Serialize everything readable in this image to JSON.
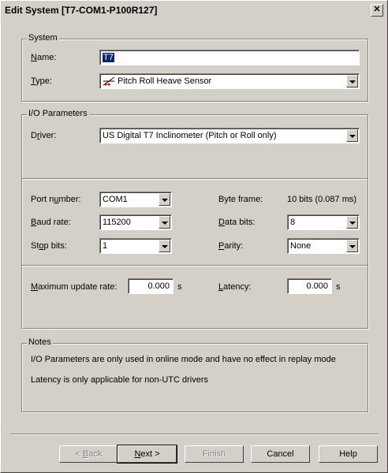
{
  "window": {
    "title": "Edit System [T7-COM1-P100R127]",
    "close_glyph": "✕"
  },
  "system": {
    "legend": "System",
    "name_label_u": "N",
    "name_label_rest": "ame:",
    "name_value": "T7",
    "type_label_u": "T",
    "type_label_rest": "ype:",
    "type_value": "Pitch Roll Heave Sensor",
    "type_icon": "pitch-roll-heave-icon"
  },
  "io": {
    "legend": "I/O Parameters",
    "driver_label_pre": "D",
    "driver_label_u": "r",
    "driver_label_rest": "iver:",
    "driver_value": "US Digital T7 Inclinometer (Pitch or Roll only)",
    "port_label_pre": "Port n",
    "port_label_u": "u",
    "port_label_rest": "mber:",
    "port_value": "COM1",
    "baud_label_u": "B",
    "baud_label_rest": "aud rate:",
    "baud_value": "115200",
    "stop_label_pre": "St",
    "stop_label_u": "o",
    "stop_label_rest": "p bits:",
    "stop_value": "1",
    "byteframe_label": "Byte frame:",
    "byteframe_value": "10 bits (0.087 ms)",
    "databits_label_u": "D",
    "databits_label_rest": "ata bits:",
    "databits_value": "8",
    "parity_label_u": "P",
    "parity_label_rest": "arity:",
    "parity_value": "None",
    "maxrate_label_u": "M",
    "maxrate_label_rest": "aximum update rate:",
    "maxrate_value": "0.000",
    "maxrate_unit": "s",
    "latency_label_u": "L",
    "latency_label_rest": "atency:",
    "latency_value": "0.000",
    "latency_unit": "s"
  },
  "notes": {
    "legend": "Notes",
    "line1": "I/O Parameters are only used in online mode and have no effect in replay mode",
    "line2": "Latency is only applicable for non-UTC drivers"
  },
  "buttons": {
    "back_pre": "< ",
    "back_u": "B",
    "back_rest": "ack",
    "next_u": "N",
    "next_rest": "ext >",
    "finish": "Finish",
    "cancel": "Cancel",
    "help": "Help"
  }
}
